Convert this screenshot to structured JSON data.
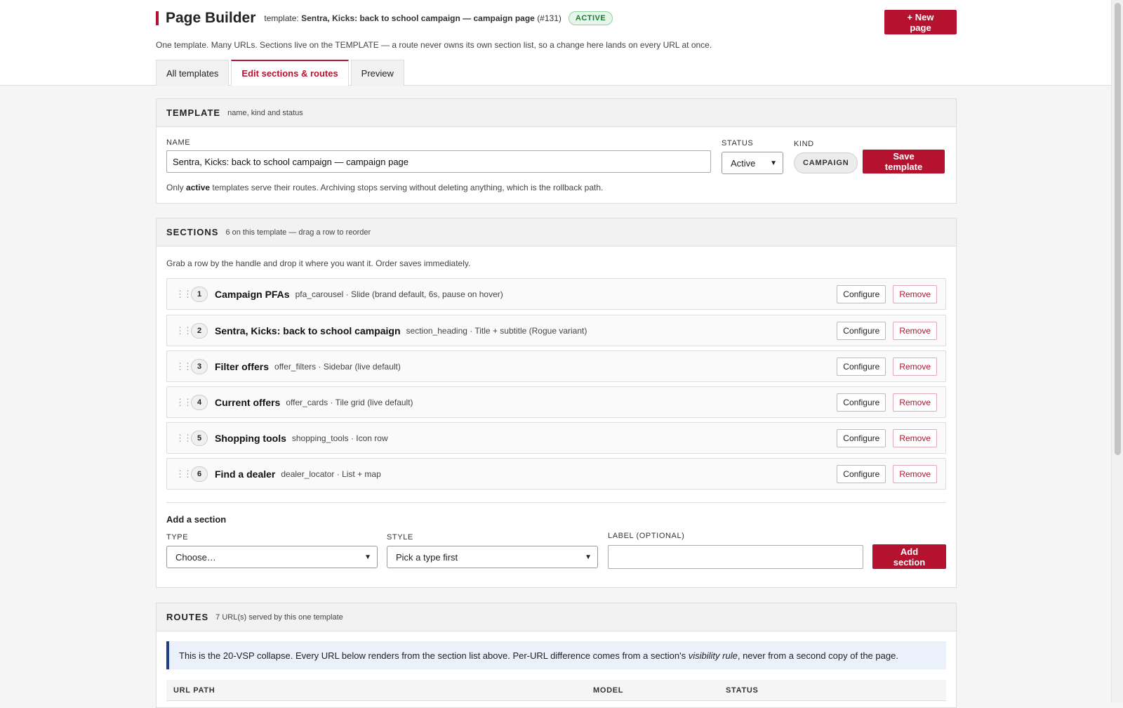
{
  "header": {
    "title": "Page Builder",
    "template_prefix": "template:",
    "template_name": "Sentra, Kicks: back to school campaign — campaign page",
    "template_id": "(#131)",
    "status_badge": "ACTIVE",
    "new_page_label": "+ New page",
    "subtitle": "One template. Many URLs. Sections live on the TEMPLATE — a route never owns its own section list, so a change here lands on every URL at once."
  },
  "tabs": [
    {
      "label": "All templates",
      "active": false
    },
    {
      "label": "Edit sections & routes",
      "active": true
    },
    {
      "label": "Preview",
      "active": false
    }
  ],
  "template_panel": {
    "heading": "TEMPLATE",
    "subheading": "name, kind and status",
    "name_label": "NAME",
    "name_value": "Sentra, Kicks: back to school campaign — campaign page",
    "status_label": "STATUS",
    "status_value": "Active",
    "kind_label": "KIND",
    "kind_value": "CAMPAIGN",
    "save_label": "Save template",
    "help_prefix": "Only",
    "help_bold": "active",
    "help_suffix": "templates serve their routes. Archiving stops serving without deleting anything, which is the rollback path."
  },
  "sections_panel": {
    "heading": "SECTIONS",
    "subheading": "6 on this template — drag a row to reorder",
    "intro": "Grab a row by the handle and drop it where you want it. Order saves immediately.",
    "configure_label": "Configure",
    "remove_label": "Remove",
    "items": [
      {
        "num": "1",
        "name": "Campaign PFAs",
        "desc": "pfa_carousel · Slide (brand default, 6s, pause on hover)"
      },
      {
        "num": "2",
        "name": "Sentra, Kicks: back to school campaign",
        "desc": "section_heading · Title + subtitle (Rogue variant)"
      },
      {
        "num": "3",
        "name": "Filter offers",
        "desc": "offer_filters · Sidebar (live default)"
      },
      {
        "num": "4",
        "name": "Current offers",
        "desc": "offer_cards · Tile grid (live default)"
      },
      {
        "num": "5",
        "name": "Shopping tools",
        "desc": "shopping_tools · Icon row"
      },
      {
        "num": "6",
        "name": "Find a dealer",
        "desc": "dealer_locator · List + map"
      }
    ],
    "add": {
      "title": "Add a section",
      "type_label": "TYPE",
      "type_value": "Choose…",
      "style_label": "STYLE",
      "style_value": "Pick a type first",
      "label_label": "LABEL (OPTIONAL)",
      "label_value": "",
      "button": "Add section"
    }
  },
  "routes_panel": {
    "heading": "ROUTES",
    "subheading": "7 URL(s) served by this one template",
    "info_prefix": "This is the 20-VSP collapse. Every URL below renders from the section list above. Per-URL difference comes from a section's",
    "info_italic": "visibility rule",
    "info_suffix": ", never from a second copy of the page.",
    "columns": [
      "URL PATH",
      "MODEL",
      "STATUS"
    ]
  }
}
